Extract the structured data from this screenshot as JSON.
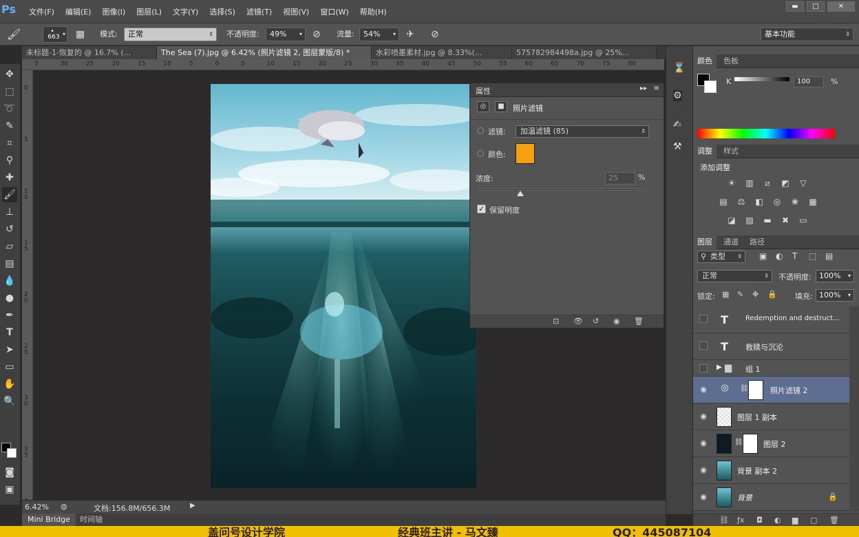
{
  "app": {
    "logo": "Ps"
  },
  "menubar": {
    "items": [
      "文件(F)",
      "编辑(E)",
      "图像(I)",
      "图层(L)",
      "文字(Y)",
      "选择(S)",
      "滤镜(T)",
      "视图(V)",
      "窗口(W)",
      "帮助(H)"
    ]
  },
  "options": {
    "brush_size": "663",
    "mode_label": "模式:",
    "mode_value": "正常",
    "opacity_label": "不透明度:",
    "opacity_value": "49%",
    "flow_label": "流量:",
    "flow_value": "54%",
    "workspace": "基本功能"
  },
  "tabs": [
    {
      "label": "未标题-1-恢复的 @ 16.7% (..."
    },
    {
      "label": "The Sea (7).jpg @ 6.42% (照片滤镜 2, 图层蒙版/8) *"
    },
    {
      "label": "水彩喷墨素材.jpg @ 8.33%(..."
    },
    {
      "label": "575782984498a.jpg @ 25%..."
    }
  ],
  "ruler": {
    "h": [
      "5",
      "30",
      "25",
      "20",
      "15",
      "10",
      "5",
      "0",
      "5",
      "10",
      "15",
      "20",
      "25",
      "30",
      "35",
      "40",
      "45",
      "50",
      "55",
      "60",
      "65",
      "70",
      "75",
      "80"
    ],
    "v": [
      "0",
      "5",
      "1 0",
      "1 5",
      "2 0",
      "2 5",
      "3 0",
      "3 5",
      "4 0"
    ]
  },
  "properties": {
    "header": "属性",
    "title": "照片滤镜",
    "filter_label": "滤镜:",
    "filter_value": "加温滤镜 (85)",
    "color_label": "颜色:",
    "color_swatch": "#f5a10e",
    "density_label": "浓度:",
    "density_value": "25",
    "density_unit": "%",
    "density_fraction": 0.25,
    "preserve_label": "保留明度"
  },
  "status": {
    "zoom": "6.42%",
    "doc": "文档:156.8M/656.3M"
  },
  "bottomtabs": [
    "Mini Bridge",
    "时间轴"
  ],
  "color_panel": {
    "tabs": [
      "颜色",
      "色板"
    ],
    "channel": "K",
    "value": "100",
    "unit": "%"
  },
  "adjust_panel": {
    "tabs": [
      "调整",
      "样式"
    ],
    "title": "添加调整"
  },
  "layers_panel": {
    "tabs": [
      "图层",
      "通道",
      "路径"
    ],
    "filter_label": "类型",
    "blend_mode": "正常",
    "opacity_label": "不透明度:",
    "opacity_value": "100%",
    "lock_label": "锁定:",
    "fill_label": "填充:",
    "fill_value": "100%",
    "layers": [
      {
        "name": "Redemption and destruct...",
        "visible": false,
        "kind": "text"
      },
      {
        "name": "救赎与沉沦",
        "visible": false,
        "kind": "text"
      },
      {
        "name": "组 1",
        "visible": false,
        "kind": "group"
      },
      {
        "name": "照片滤镜 2",
        "visible": true,
        "kind": "adjust",
        "selected": true
      },
      {
        "name": "图层 1 副本",
        "visible": true,
        "kind": "pixel"
      },
      {
        "name": "图层 2",
        "visible": true,
        "kind": "masked"
      },
      {
        "name": "背景 副本 2",
        "visible": true,
        "kind": "pixel"
      },
      {
        "name": "背景",
        "visible": true,
        "kind": "background"
      }
    ]
  },
  "footer": {
    "school": "盖问号设计学院",
    "lecture": "经典班主讲 - 马文臻",
    "qq": "QQ：445087104"
  }
}
